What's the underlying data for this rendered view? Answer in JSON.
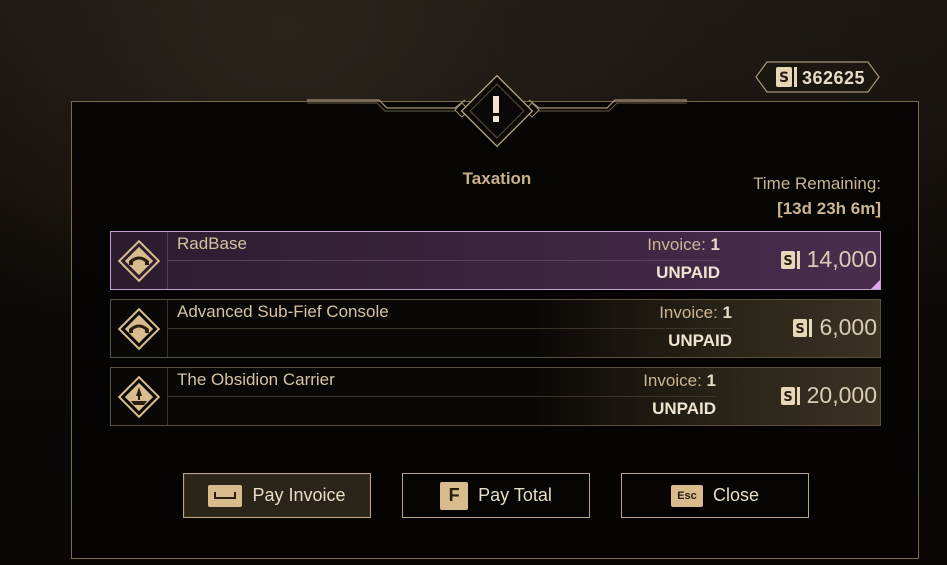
{
  "currency": {
    "icon": "dollar-s-icon",
    "amount": "362625"
  },
  "header": {
    "alert_icon": "exclamation-icon",
    "title": "Taxation"
  },
  "time": {
    "label": "Time Remaining:",
    "value": "[13d 23h 6m]"
  },
  "invoices": [
    {
      "icon": "bridge-icon",
      "name": "RadBase",
      "invoice_label": "Invoice:",
      "invoice_number": "1",
      "status": "UNPAID",
      "amount": "14,000",
      "selected": true
    },
    {
      "icon": "bridge-icon",
      "name": "Advanced Sub-Fief Console",
      "invoice_label": "Invoice:",
      "invoice_number": "1",
      "status": "UNPAID",
      "amount": "6,000",
      "selected": false
    },
    {
      "icon": "ship-icon",
      "name": "The Obsidion Carrier",
      "invoice_label": "Invoice:",
      "invoice_number": "1",
      "status": "UNPAID",
      "amount": "20,000",
      "selected": false
    }
  ],
  "buttons": {
    "pay_invoice": {
      "key": "space-key-icon",
      "label": "Pay Invoice"
    },
    "pay_total": {
      "key": "F",
      "label": "Pay Total"
    },
    "close": {
      "key": "Esc",
      "label": "Close"
    }
  },
  "colors": {
    "accent": "#d8bc8e",
    "selected_border": "#c59ed3",
    "selected_bg": "#3c2440"
  }
}
